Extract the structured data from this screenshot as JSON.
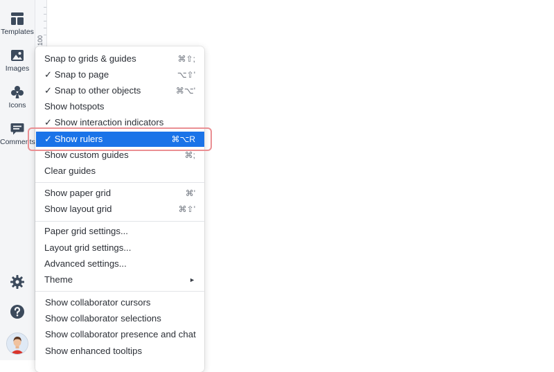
{
  "sidebar": {
    "items": [
      {
        "label": "Templates",
        "icon": "templates-icon"
      },
      {
        "label": "Images",
        "icon": "image-icon"
      },
      {
        "label": "Icons",
        "icon": "club-icon"
      },
      {
        "label": "Comments",
        "icon": "comment-icon"
      }
    ],
    "bottom": [
      {
        "icon": "gear-icon"
      },
      {
        "icon": "help-icon"
      },
      {
        "icon": "avatar"
      }
    ]
  },
  "ruler": {
    "label": "100"
  },
  "menu": {
    "group1": [
      {
        "label": "Snap to grids & guides",
        "shortcut": "⌘⇧;"
      },
      {
        "label": "✓ Snap to page",
        "shortcut": "⌥⇧'"
      },
      {
        "label": "✓ Snap to other objects",
        "shortcut": "⌘⌥'"
      },
      {
        "label": "Show hotspots",
        "shortcut": ""
      },
      {
        "label": "✓ Show interaction indicators",
        "shortcut": ""
      },
      {
        "label": "✓ Show rulers",
        "shortcut": "⌘⌥R"
      },
      {
        "label": "Show custom guides",
        "shortcut": "⌘;"
      },
      {
        "label": "Clear guides",
        "shortcut": ""
      }
    ],
    "group2": [
      {
        "label": "Show paper grid",
        "shortcut": "⌘'"
      },
      {
        "label": "Show layout grid",
        "shortcut": "⌘⇧'"
      }
    ],
    "group3": [
      {
        "label": "Paper grid settings..."
      },
      {
        "label": "Layout grid settings..."
      },
      {
        "label": "Advanced settings..."
      },
      {
        "label": "Theme",
        "submenu": "►"
      }
    ],
    "group4": [
      {
        "label": "Show collaborator cursors"
      },
      {
        "label": "Show collaborator selections"
      },
      {
        "label": "Show collaborator presence and chat"
      },
      {
        "label": "Show enhanced tooltips"
      }
    ]
  },
  "colors": {
    "accent": "#1a73e8",
    "highlight_outline": "#ea8f93",
    "rail_icon": "#3c4a5c"
  }
}
